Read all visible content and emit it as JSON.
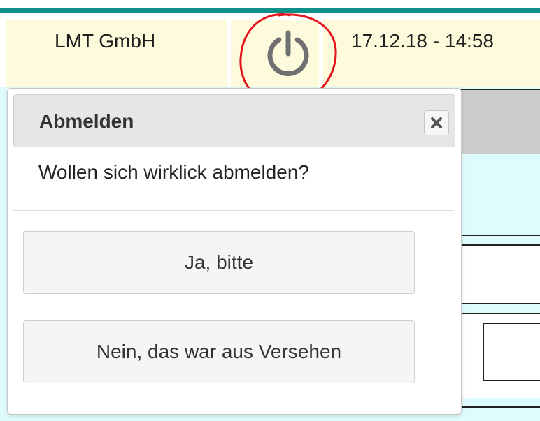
{
  "header": {
    "company": "LMT GmbH",
    "datetime": "17.12.18 - 14:58",
    "logout_icon": "power-icon"
  },
  "annotation": {
    "color": "#e3141b"
  },
  "dialog": {
    "title": "Abmelden",
    "close_icon": "close-icon",
    "message": "Wollen sich wirklick abmelden?",
    "buttons": {
      "confirm": "Ja, bitte",
      "cancel": "Nein, das war aus Versehen"
    }
  },
  "colors": {
    "accent_bar": "#0f8f8a",
    "header_bg": "#fdfbdc",
    "page_bg": "#dffcfc"
  }
}
